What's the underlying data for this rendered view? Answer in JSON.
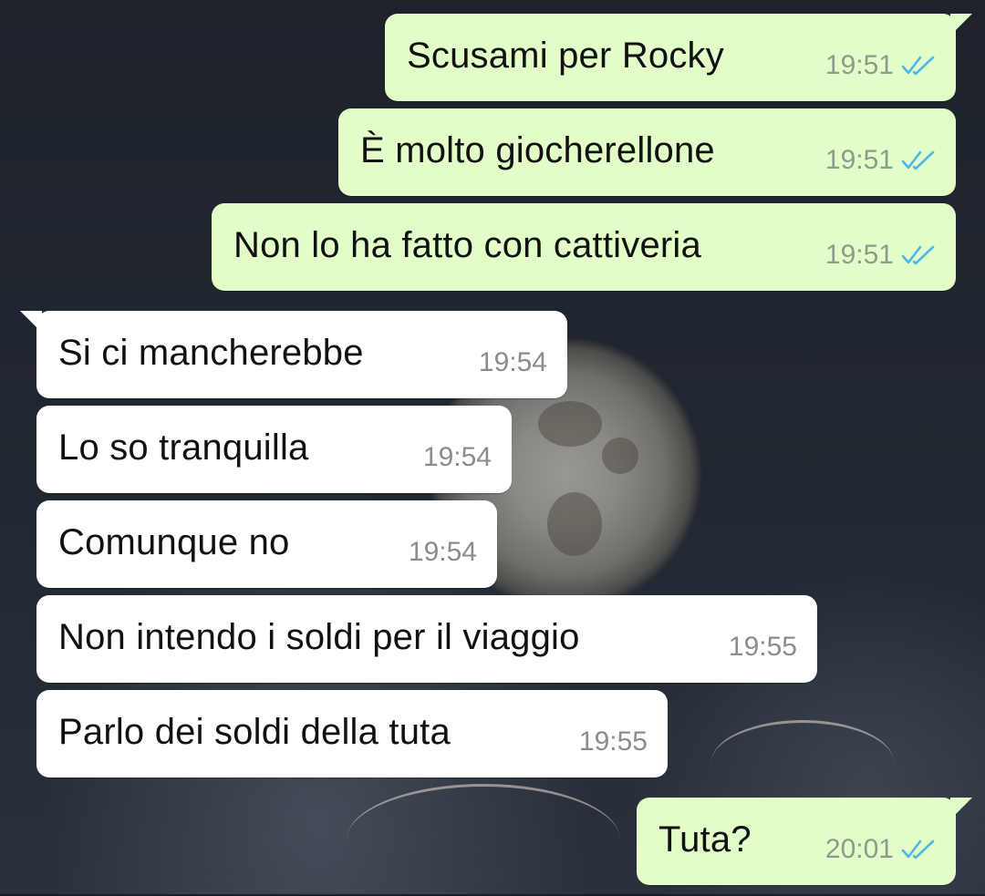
{
  "chat": {
    "messages": [
      {
        "text": "Scusami per Rocky",
        "time": "19:51",
        "direction": "outgoing",
        "status": "read"
      },
      {
        "text": "È molto giocherellone",
        "time": "19:51",
        "direction": "outgoing",
        "status": "read"
      },
      {
        "text": "Non lo ha fatto con cattiveria",
        "time": "19:51",
        "direction": "outgoing",
        "status": "read"
      },
      {
        "text": "Si ci mancherebbe",
        "time": "19:54",
        "direction": "incoming"
      },
      {
        "text": "Lo so tranquilla",
        "time": "19:54",
        "direction": "incoming"
      },
      {
        "text": "Comunque no",
        "time": "19:54",
        "direction": "incoming"
      },
      {
        "text": "Non intendo i soldi per il viaggio",
        "time": "19:55",
        "direction": "incoming"
      },
      {
        "text": "Parlo dei soldi della tuta",
        "time": "19:55",
        "direction": "incoming"
      },
      {
        "text": "Tuta?",
        "time": "20:01",
        "direction": "outgoing",
        "status": "read"
      }
    ]
  },
  "colors": {
    "outgoing_bubble": "#e3fdc9",
    "incoming_bubble": "#ffffff",
    "read_ticks": "#4fb6ec",
    "wallpaper": "#1d222b"
  },
  "icons": {
    "read_receipt": "double-check-icon"
  }
}
